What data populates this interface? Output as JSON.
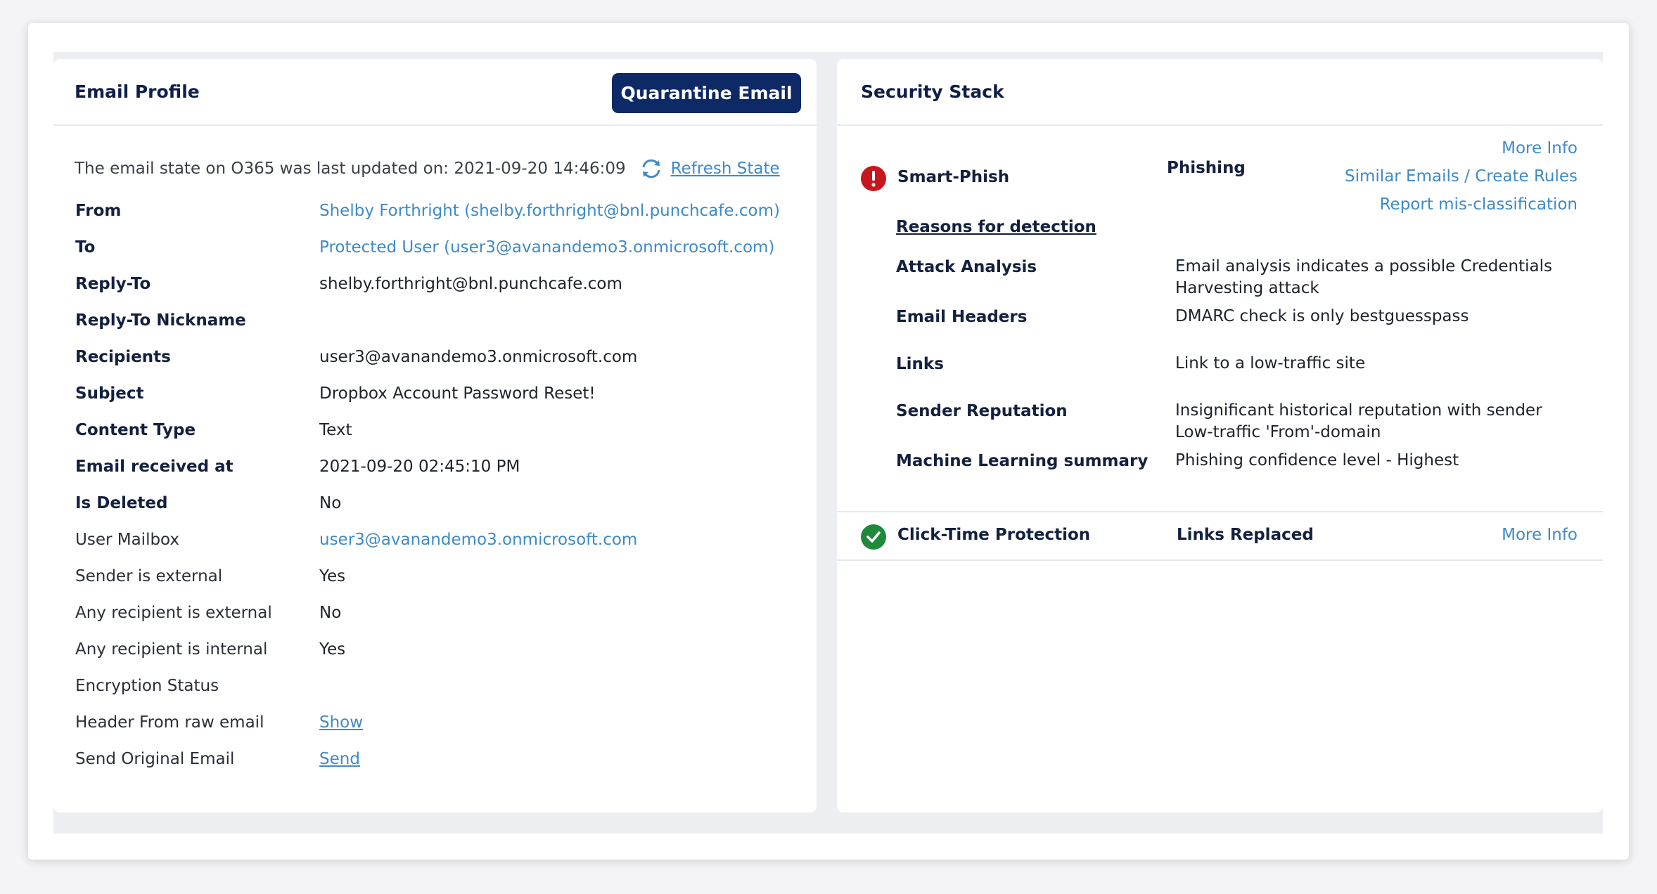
{
  "email_profile": {
    "title": "Email Profile",
    "quarantine_label": "Quarantine Email",
    "state_text": "The email state on O365 was last updated on: 2021-09-20 14:46:09",
    "refresh_label": "Refresh State",
    "fields": [
      {
        "label": "From",
        "value": "Shelby Forthright (shelby.forthright@bnl.punchcafe.com)"
      },
      {
        "label": "To",
        "value": "Protected User (user3@avanandemo3.onmicrosoft.com)"
      },
      {
        "label": "Reply-To",
        "value": "shelby.forthright@bnl.punchcafe.com"
      },
      {
        "label": "Reply-To Nickname",
        "value": ""
      },
      {
        "label": "Recipients",
        "value": "user3@avanandemo3.onmicrosoft.com"
      },
      {
        "label": "Subject",
        "value": "Dropbox Account Password Reset!"
      },
      {
        "label": "Content Type",
        "value": "Text"
      },
      {
        "label": "Email received at",
        "value": "2021-09-20 02:45:10 PM"
      },
      {
        "label": "Is Deleted",
        "value": "No"
      },
      {
        "label": "User Mailbox",
        "value": "user3@avanandemo3.onmicrosoft.com"
      },
      {
        "label": "Sender is external",
        "value": "Yes"
      },
      {
        "label": "Any recipient is external",
        "value": "No"
      },
      {
        "label": "Any recipient is internal",
        "value": "Yes"
      },
      {
        "label": "Encryption Status",
        "value": ""
      },
      {
        "label": "Header From raw email",
        "value": "Show"
      },
      {
        "label": "Send Original Email",
        "value": "Send"
      }
    ]
  },
  "security_stack": {
    "title": "Security Stack",
    "smart_phish": {
      "name": "Smart-Phish",
      "verdict": "Phishing",
      "links": [
        "More Info",
        "Similar Emails / Create Rules",
        "Report mis-classification"
      ],
      "reasons_label": "Reasons for detection",
      "reasons": [
        {
          "label": "Attack Analysis",
          "value": "Email analysis indicates a possible Credentials Harvesting attack"
        },
        {
          "label": "Email Headers",
          "value": "DMARC check is only bestguesspass"
        },
        {
          "label": "Links",
          "value": "Link to a low-traffic site"
        },
        {
          "label": "Sender Reputation",
          "value": "Insignificant historical reputation with sender Low-traffic 'From'-domain"
        },
        {
          "label": "Machine Learning summary",
          "value": "Phishing confidence level - Highest"
        }
      ]
    },
    "click_time": {
      "name": "Click-Time Protection",
      "verdict": "Links Replaced",
      "more_info": "More Info"
    }
  },
  "colors": {
    "primary_dark": "#0d2a66",
    "link": "#3e8ac8",
    "alert": "#c8161f",
    "success": "#1e8a3a"
  }
}
